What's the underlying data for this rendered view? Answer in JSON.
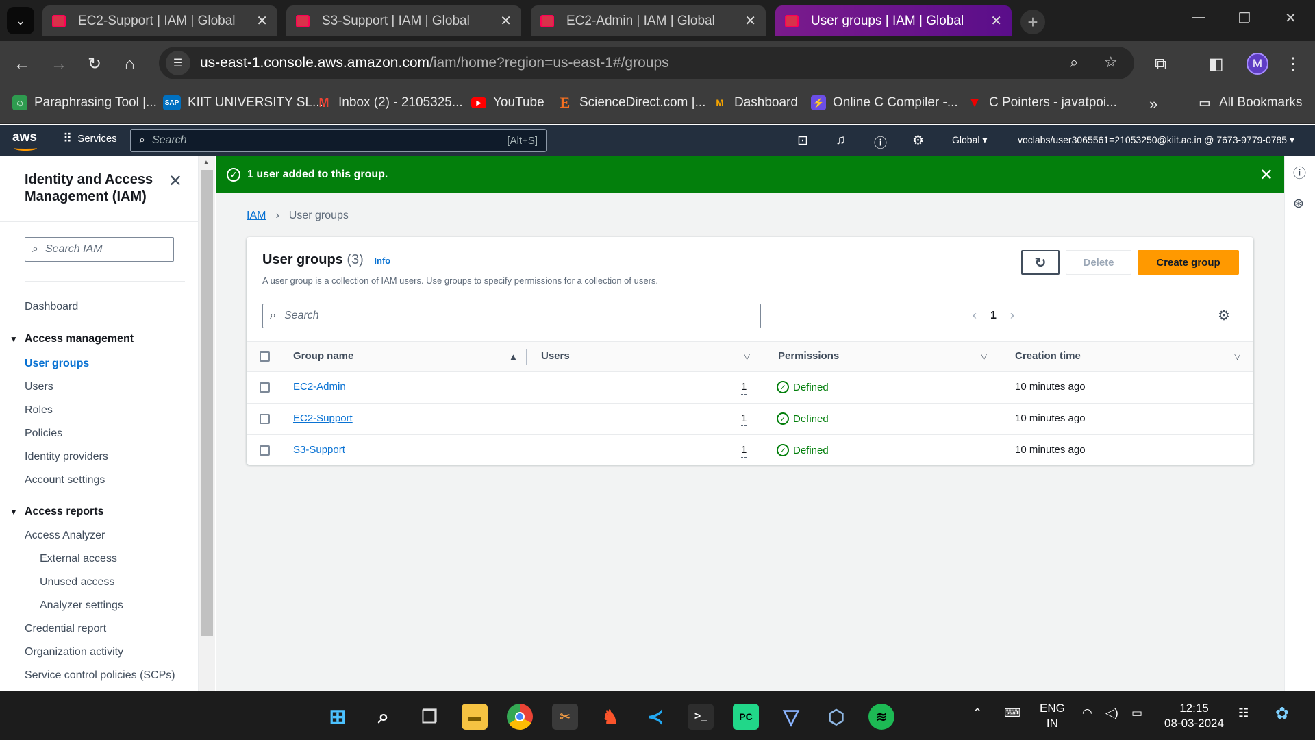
{
  "browser": {
    "tabs": [
      {
        "label": "EC2-Support | IAM | Global",
        "active": false
      },
      {
        "label": "S3-Support | IAM | Global",
        "active": false
      },
      {
        "label": "EC2-Admin | IAM | Global",
        "active": false
      },
      {
        "label": "User groups | IAM | Global",
        "active": true
      }
    ],
    "url_host": "us-east-1.console.aws.amazon.com",
    "url_path": "/iam/home?region=us-east-1#/groups",
    "profile_initial": "M",
    "bookmarks": [
      {
        "label": "Paraphrasing Tool |...",
        "icon": "robot-icon"
      },
      {
        "label": "KIIT UNIVERSITY SL...",
        "icon": "sap-icon"
      },
      {
        "label": "Inbox (2) - 2105325...",
        "icon": "gmail-icon"
      },
      {
        "label": "YouTube",
        "icon": "youtube-icon"
      },
      {
        "label": "ScienceDirect.com |...",
        "icon": "elsevier-icon"
      },
      {
        "label": "Dashboard",
        "icon": "dashboard-icon"
      },
      {
        "label": "Online C Compiler -...",
        "icon": "compiler-icon"
      },
      {
        "label": "C Pointers - javatpoi...",
        "icon": "javatpoint-icon"
      }
    ],
    "all_bookmarks": "All Bookmarks"
  },
  "aws": {
    "logo": "aws",
    "services": "Services",
    "search_placeholder": "Search",
    "search_shortcut": "[Alt+S]",
    "region": "Global",
    "account": "voclabs/user3065561=21053250@kiit.ac.in @ 7673-9779-0785"
  },
  "sidebar": {
    "title": "Identity and Access Management (IAM)",
    "search_placeholder": "Search IAM",
    "dashboard": "Dashboard",
    "access_management": "Access management",
    "am_items": [
      "User groups",
      "Users",
      "Roles",
      "Policies",
      "Identity providers",
      "Account settings"
    ],
    "access_reports": "Access reports",
    "access_analyzer": "Access Analyzer",
    "analyzer_sub": [
      "External access",
      "Unused access",
      "Analyzer settings"
    ],
    "report_items": [
      "Credential report",
      "Organization activity",
      "Service control policies (SCPs)"
    ]
  },
  "flash": {
    "message": "1 user added to this group."
  },
  "breadcrumb": {
    "root": "IAM",
    "current": "User groups"
  },
  "panel": {
    "title": "User groups",
    "count": "(3)",
    "info": "Info",
    "description": "A user group is a collection of IAM users. Use groups to specify permissions for a collection of users.",
    "delete_label": "Delete",
    "create_label": "Create group",
    "search_placeholder": "Search",
    "page": "1",
    "columns": [
      "Group name",
      "Users",
      "Permissions",
      "Creation time"
    ],
    "rows": [
      {
        "name": "EC2-Admin",
        "users": "1",
        "permissions": "Defined",
        "created": "10 minutes ago"
      },
      {
        "name": "EC2-Support",
        "users": "1",
        "permissions": "Defined",
        "created": "10 minutes ago"
      },
      {
        "name": "S3-Support",
        "users": "1",
        "permissions": "Defined",
        "created": "10 minutes ago"
      }
    ]
  },
  "taskbar": {
    "lang": "ENG",
    "region": "IN",
    "time": "12:15",
    "date": "08-03-2024"
  },
  "colors": {
    "accent": "#0972d3",
    "success": "#037f0c",
    "primary_button": "#ff9900",
    "aws_nav": "#232f3e"
  }
}
